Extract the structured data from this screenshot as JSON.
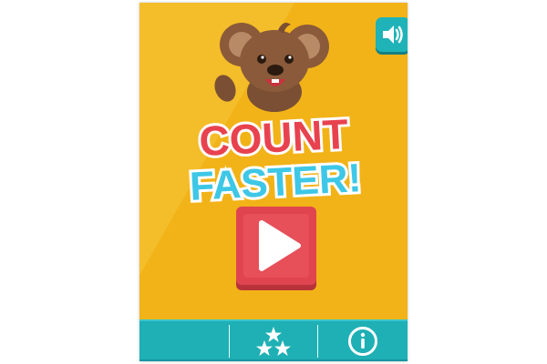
{
  "game": {
    "logo": {
      "line1": "COUNT",
      "line2": "FASTER!"
    },
    "colors": {
      "background": "#f2b318",
      "accent_teal": "#1fb3b8",
      "logo_red": "#e8424f",
      "logo_teal": "#3ec7e6",
      "play_red": "#e0454f"
    },
    "icons": {
      "sound": "speaker-icon",
      "play": "play-triangle-icon",
      "stars": "stars-icon",
      "info": "info-icon"
    }
  }
}
